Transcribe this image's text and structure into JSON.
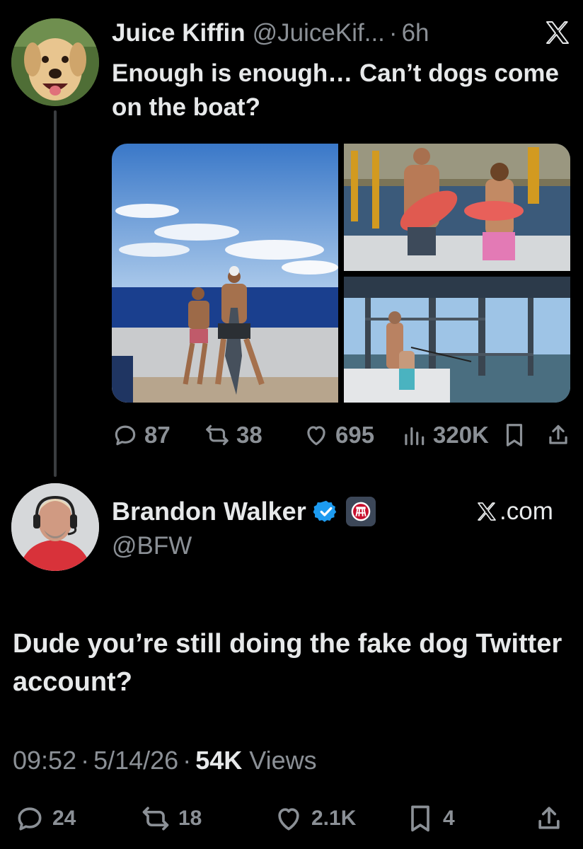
{
  "tweet": {
    "author_name": "Juice Kiffin",
    "author_handle": "@JuiceKif...",
    "separator": "·",
    "age": "6h",
    "text": "Enough is enough… Can’t dogs come on the boat?",
    "media_count": 3,
    "stats": {
      "replies": "87",
      "retweets": "38",
      "likes": "695",
      "views": "320K"
    }
  },
  "reply": {
    "author_name": "Brandon Walker",
    "author_handle": "@BFW",
    "source": ".com",
    "text": "Dude you’re still doing the fake dog Twitter account?",
    "time": "09:52",
    "date": "5/14/26",
    "views_count": "54K",
    "views_label": "Views",
    "separator": "·",
    "stats": {
      "replies": "24",
      "retweets": "18",
      "likes": "2.1K",
      "bookmarks": "4"
    }
  },
  "icons": [
    "x-logo",
    "reply-icon",
    "retweet-icon",
    "like-icon",
    "views-icon",
    "bookmark-icon",
    "share-icon",
    "verified-badge-icon",
    "barstool-badge-icon"
  ],
  "colors": {
    "background": "#000000",
    "text": "#e7e9ea",
    "muted": "#8b9096",
    "verified": "#1d9bf0"
  }
}
